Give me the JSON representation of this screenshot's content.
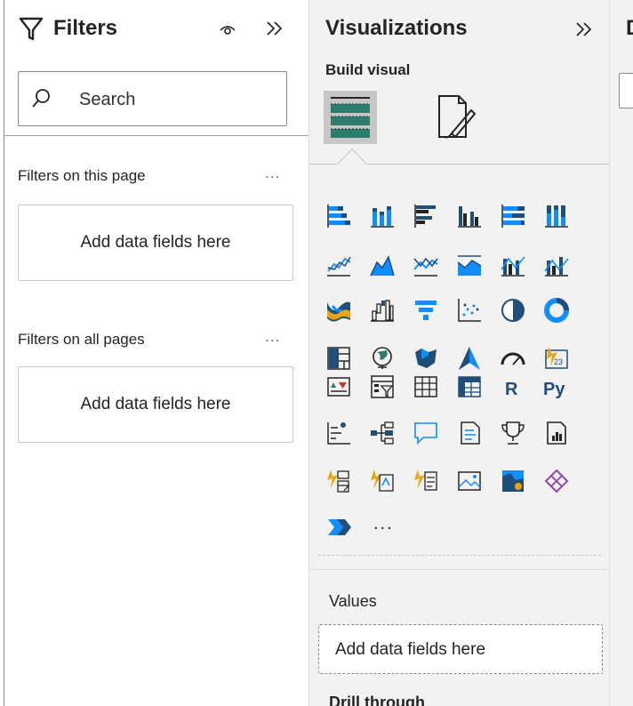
{
  "filters": {
    "title": "Filters",
    "search_placeholder": "Search",
    "sections": [
      {
        "label": "Filters on this page",
        "more": "...",
        "drop": "Add data fields here"
      },
      {
        "label": "Filters on all pages",
        "more": "...",
        "drop": "Add data fields here"
      }
    ]
  },
  "visualizations": {
    "title": "Visualizations",
    "subtitle": "Build visual",
    "more_visuals": "...",
    "values_label": "Values",
    "values_drop": "Add data fields here",
    "drill_label": "Drill through"
  },
  "data_pane": {
    "title_initial": "D"
  },
  "icons": [
    "stacked-bar-icon",
    "stacked-column-icon",
    "clustered-bar-icon",
    "clustered-column-icon",
    "100-stacked-bar-icon",
    "100-stacked-column-icon",
    "line-chart-icon",
    "area-chart-icon",
    "stacked-area-icon",
    "line-stacked-column-icon",
    "line-clustered-column-icon",
    "ribbon-chart-icon",
    "waterfall-chart-icon",
    "funnel-chart-icon",
    "scatter-chart-icon",
    "pie-chart-icon",
    "donut-chart-icon",
    "treemap-icon",
    "map-icon",
    "filled-map-icon",
    "shape-map-icon",
    "azure-map-icon",
    "gauge-icon",
    "card-icon",
    "kpi-icon",
    "slicer-icon",
    "table-icon",
    "matrix-icon",
    "r-visual-icon",
    "python-visual-icon",
    "key-influencers-icon",
    "decomposition-tree-icon",
    "qa-icon",
    "smart-narrative-icon",
    "metrics-icon",
    "paginated-report-icon",
    "power-apps-icon",
    "power-automate-icon",
    "power-bi-visual-icon",
    "image-visual-icon",
    "arcgis-map-icon",
    "composite-icon",
    "power-automate-flow-icon"
  ],
  "colors": {
    "accent": "#118dff",
    "teal": "#2d7d6f",
    "orange": "#e8a317",
    "navy": "#1f4e79",
    "purple": "#8e44ad"
  }
}
